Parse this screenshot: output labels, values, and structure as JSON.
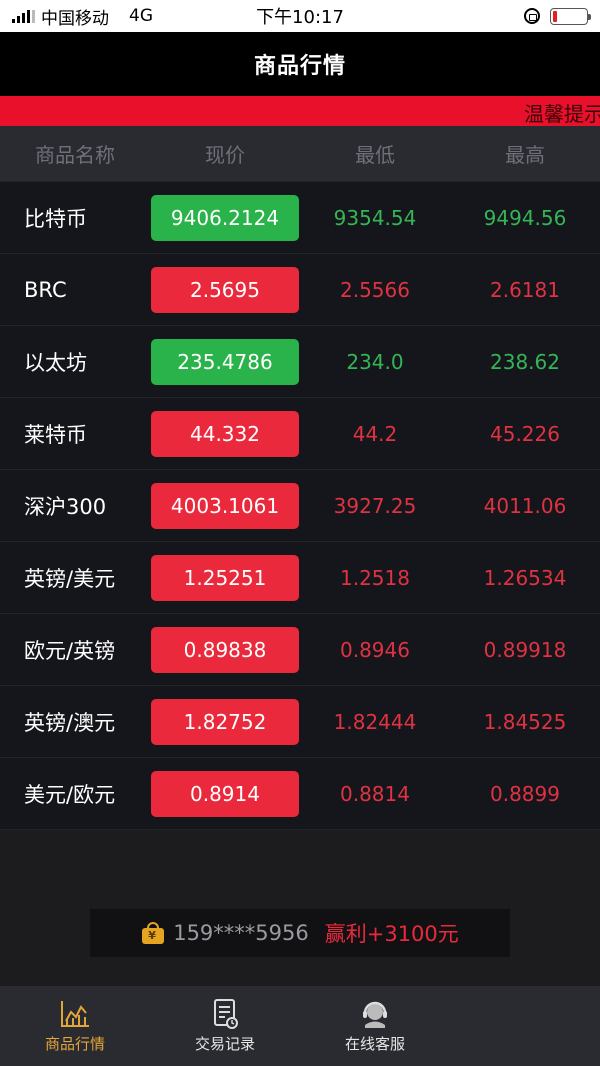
{
  "status_bar": {
    "carrier": "中国移动",
    "network": "4G",
    "time": "下午10:17"
  },
  "header": {
    "title": "商品行情"
  },
  "marquee": {
    "text": "温馨提示"
  },
  "table": {
    "columns": [
      "商品名称",
      "现价",
      "最低",
      "最高"
    ],
    "rows": [
      {
        "name": "比特币",
        "price": "9406.2124",
        "low": "9354.54",
        "high": "9494.56",
        "trend": "up"
      },
      {
        "name": "BRC",
        "price": "2.5695",
        "low": "2.5566",
        "high": "2.6181",
        "trend": "down"
      },
      {
        "name": "以太坊",
        "price": "235.4786",
        "low": "234.0",
        "high": "238.62",
        "trend": "up"
      },
      {
        "name": "莱特币",
        "price": "44.332",
        "low": "44.2",
        "high": "45.226",
        "trend": "down"
      },
      {
        "name": "深沪300",
        "price": "4003.1061",
        "low": "3927.25",
        "high": "4011.06",
        "trend": "down"
      },
      {
        "name": "英镑/美元",
        "price": "1.25251",
        "low": "1.2518",
        "high": "1.26534",
        "trend": "down"
      },
      {
        "name": "欧元/英镑",
        "price": "0.89838",
        "low": "0.8946",
        "high": "0.89918",
        "trend": "down"
      },
      {
        "name": "英镑/澳元",
        "price": "1.82752",
        "low": "1.82444",
        "high": "1.84525",
        "trend": "down"
      },
      {
        "name": "美元/欧元",
        "price": "0.8914",
        "low": "0.8814",
        "high": "0.8899",
        "trend": "down"
      }
    ]
  },
  "notice": {
    "icon": "money-bag-icon",
    "phone": "159****5956",
    "profit": "赢利+3100元"
  },
  "tabs": [
    {
      "label": "商品行情",
      "icon": "chart-icon",
      "active": true
    },
    {
      "label": "交易记录",
      "icon": "document-icon",
      "active": false
    },
    {
      "label": "在线客服",
      "icon": "headset-icon",
      "active": false
    }
  ],
  "colors": {
    "up": "#2ab24b",
    "down": "#ea2a3c",
    "accent": "#e2a53a",
    "marquee": "#e8102a"
  }
}
